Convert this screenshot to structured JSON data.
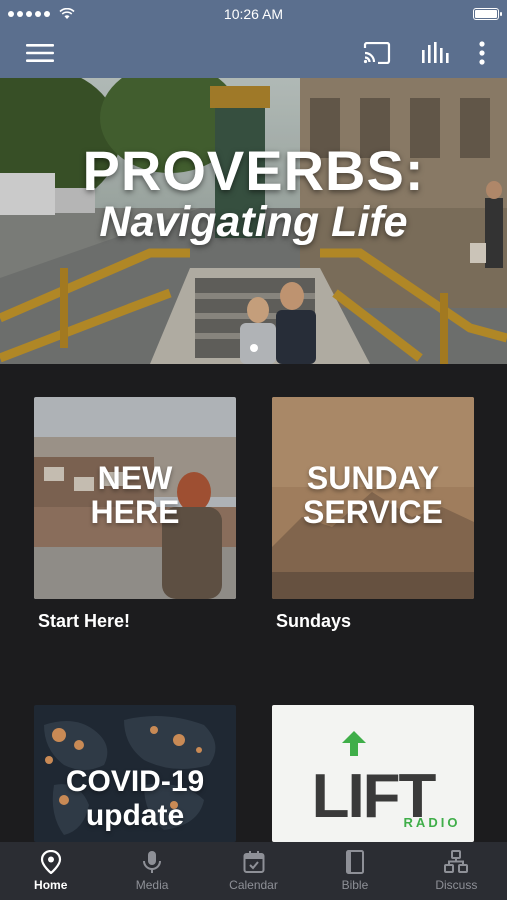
{
  "status_bar": {
    "time": "10:26 AM"
  },
  "hero": {
    "title": "PROVERBS:",
    "subtitle": "Navigating Life"
  },
  "tiles": [
    {
      "text_line1": "NEW",
      "text_line2": "HERE",
      "caption": "Start Here!"
    },
    {
      "text_line1": "SUNDAY",
      "text_line2": "SERVICE",
      "caption": "Sundays"
    },
    {
      "text_line1": "COVID-19",
      "text_line2": "update",
      "caption": ""
    },
    {
      "logo_text": "LIFT",
      "logo_sub": "RADIO",
      "caption": ""
    }
  ],
  "bottom_nav": [
    {
      "label": "Home",
      "icon": "location-pin-icon",
      "active": true
    },
    {
      "label": "Media",
      "icon": "microphone-icon",
      "active": false
    },
    {
      "label": "Calendar",
      "icon": "calendar-icon",
      "active": false
    },
    {
      "label": "Bible",
      "icon": "book-icon",
      "active": false
    },
    {
      "label": "Discuss",
      "icon": "people-icon",
      "active": false
    }
  ],
  "colors": {
    "header": "#5b6f8e",
    "background": "#1c1c1e",
    "nav_background": "#2b2d33",
    "lift_green": "#3fae49"
  }
}
